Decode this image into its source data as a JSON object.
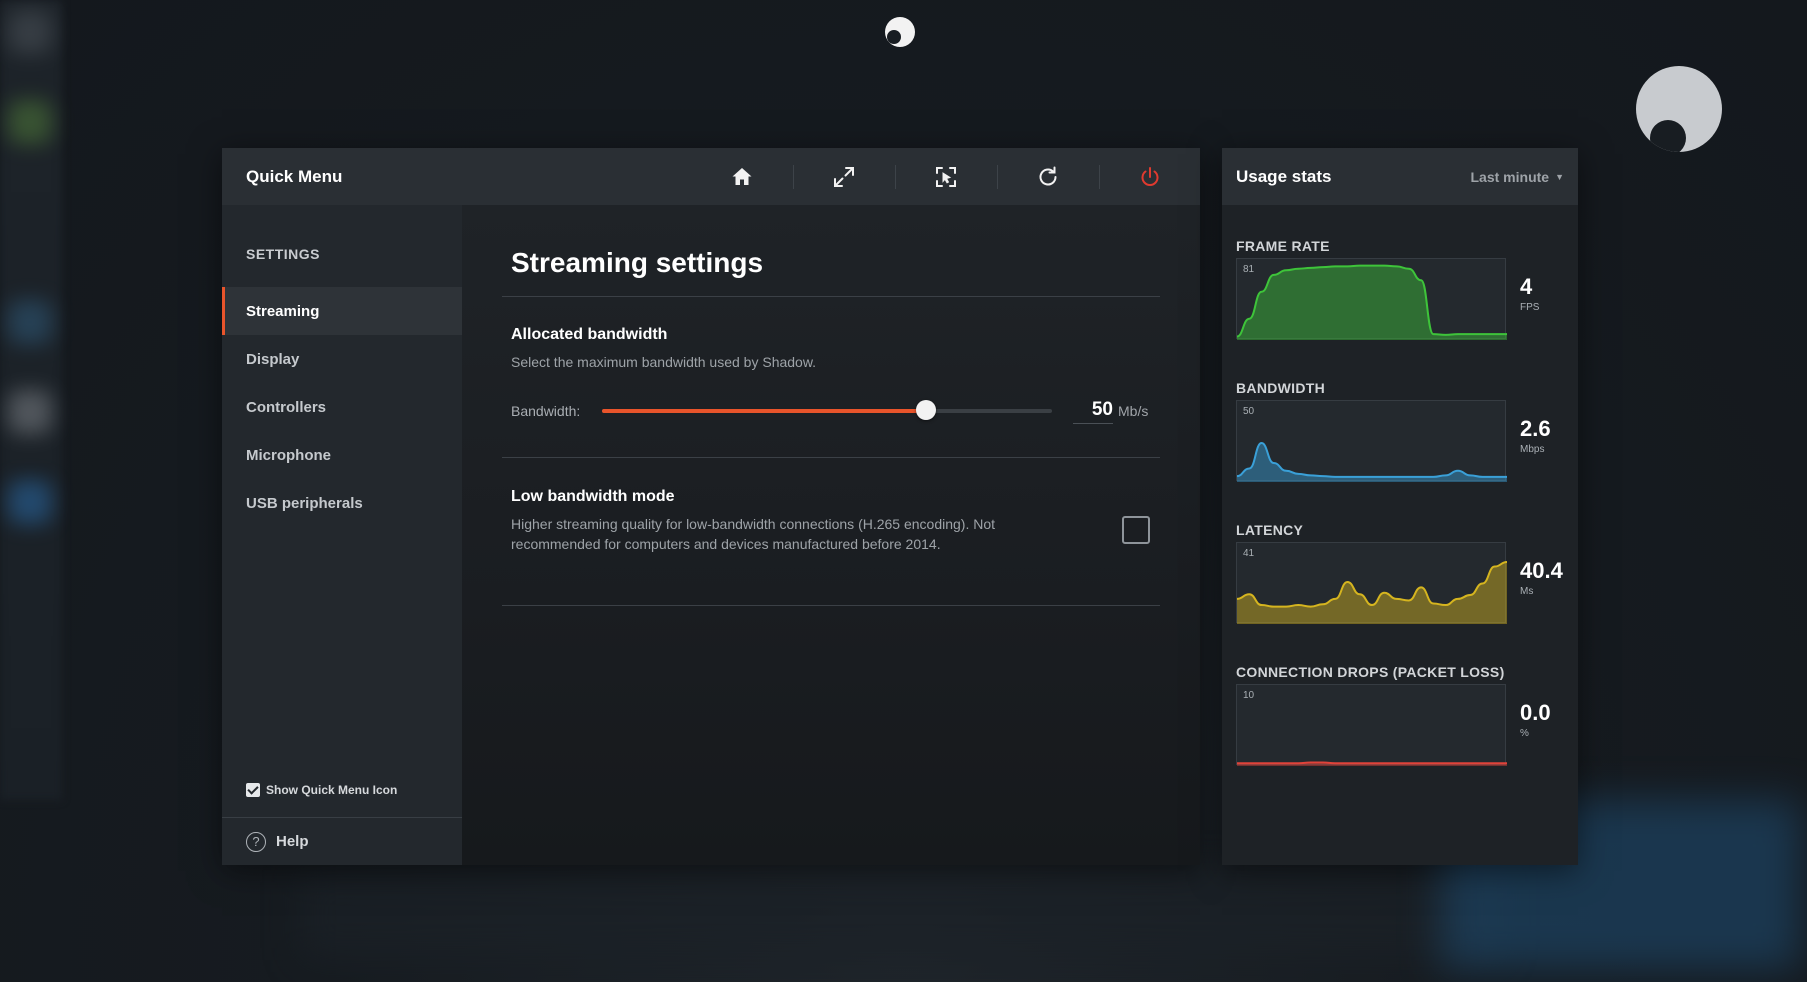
{
  "quick_menu": {
    "title": "Quick Menu",
    "toolbar": [
      {
        "name": "home-icon",
        "label": "Home"
      },
      {
        "name": "fullscreen-icon",
        "label": "Fullscreen"
      },
      {
        "name": "mouse-capture-icon",
        "label": "Capture mouse"
      },
      {
        "name": "refresh-icon",
        "label": "Refresh"
      },
      {
        "name": "power-icon",
        "label": "Power",
        "color": "#e03a2f"
      }
    ]
  },
  "sidebar": {
    "section": "SETTINGS",
    "items": [
      {
        "label": "Streaming",
        "active": true
      },
      {
        "label": "Display"
      },
      {
        "label": "Controllers"
      },
      {
        "label": "Microphone"
      },
      {
        "label": "USB peripherals"
      }
    ],
    "show_icon_label": "Show Quick Menu Icon",
    "show_icon_checked": true,
    "help_label": "Help"
  },
  "content": {
    "title": "Streaming settings",
    "bandwidth": {
      "title": "Allocated bandwidth",
      "description": "Select the maximum bandwidth used by Shadow.",
      "slider_label": "Bandwidth:",
      "value": "50",
      "unit": "Mb/s",
      "slider_fraction": 0.72
    },
    "low_bandwidth": {
      "title": "Low bandwidth mode",
      "description": "Higher streaming quality for low-bandwidth connections (H.265 encoding). Not recommended for computers and devices manufactured before 2014.",
      "checked": false
    }
  },
  "usage": {
    "title": "Usage stats",
    "range": "Last minute",
    "stats": [
      {
        "label": "FRAME RATE",
        "max": "81",
        "value": "4",
        "unit": "FPS",
        "color": "#3ec43a",
        "series": [
          0.02,
          0.25,
          0.6,
          0.82,
          0.88,
          0.9,
          0.91,
          0.92,
          0.93,
          0.93,
          0.94,
          0.94,
          0.94,
          0.93,
          0.9,
          0.75,
          0.05,
          0.04,
          0.05,
          0.05,
          0.05,
          0.05,
          0.05
        ]
      },
      {
        "label": "BANDWIDTH",
        "max": "50",
        "value": "2.6",
        "unit": "Mbps",
        "color": "#3aa0d8",
        "series": [
          0.05,
          0.15,
          0.48,
          0.22,
          0.12,
          0.08,
          0.06,
          0.05,
          0.04,
          0.04,
          0.04,
          0.04,
          0.04,
          0.04,
          0.04,
          0.04,
          0.04,
          0.06,
          0.12,
          0.06,
          0.04,
          0.04,
          0.04
        ]
      },
      {
        "label": "LATENCY",
        "max": "41",
        "value": "40.4",
        "unit": "Ms",
        "color": "#d6b51f",
        "series": [
          0.3,
          0.36,
          0.22,
          0.2,
          0.2,
          0.22,
          0.2,
          0.23,
          0.3,
          0.52,
          0.36,
          0.22,
          0.38,
          0.3,
          0.28,
          0.45,
          0.24,
          0.22,
          0.3,
          0.35,
          0.5,
          0.72,
          0.78
        ]
      },
      {
        "label": "CONNECTION DROPS (PACKET LOSS)",
        "max": "10",
        "value": "0.0",
        "unit": "%",
        "color": "#e0433a",
        "series": [
          0.01,
          0.01,
          0.01,
          0.01,
          0.01,
          0.01,
          0.02,
          0.02,
          0.01,
          0.01,
          0.01,
          0.01,
          0.01,
          0.01,
          0.01,
          0.01,
          0.01,
          0.01,
          0.01,
          0.01,
          0.01,
          0.01,
          0.01
        ]
      }
    ]
  }
}
